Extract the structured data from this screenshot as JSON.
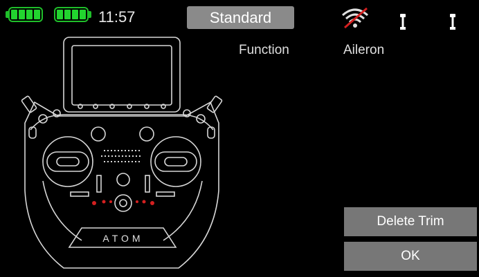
{
  "status": {
    "time": "11:57",
    "mode": "Standard",
    "icons": [
      "battery-transmitter-icon",
      "battery-receiver-icon",
      "signal-off-icon",
      "stick-left-icon",
      "stick-right-icon"
    ],
    "battery_color": "#22d42f",
    "signal_strike_color": "#d42020"
  },
  "function": {
    "label": "Function",
    "value": "Aileron"
  },
  "buttons": {
    "delete_trim": "Delete Trim",
    "ok": "OK"
  },
  "transmitter": {
    "brand": "ATOM",
    "trim_indicator_color": "#d42020"
  }
}
